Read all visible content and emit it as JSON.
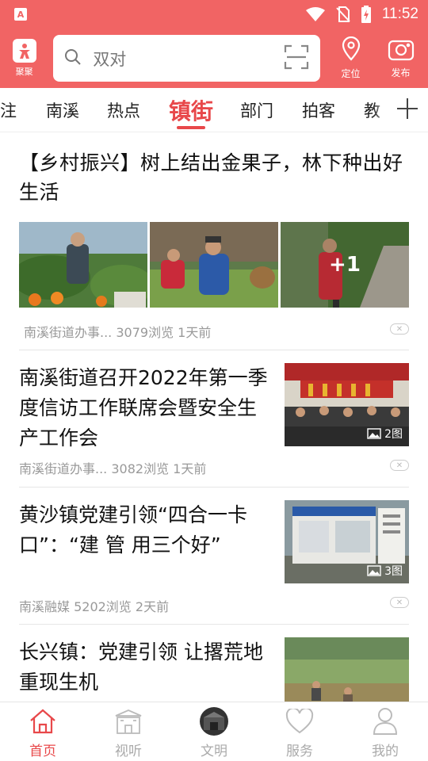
{
  "status_bar": {
    "time": "11:52",
    "app_badge": "A"
  },
  "header": {
    "logo_label": "聚聚",
    "search_placeholder": "双对",
    "location_label": "定位",
    "publish_label": "发布"
  },
  "tabs": [
    {
      "label": "注"
    },
    {
      "label": "南溪"
    },
    {
      "label": "热点"
    },
    {
      "label": "镇街",
      "active": true
    },
    {
      "label": "部门"
    },
    {
      "label": "拍客"
    },
    {
      "label": "教"
    }
  ],
  "articles": [
    {
      "title": "【乡村振兴】树上结出金果子，林下种出好生活",
      "extra_images": "+1",
      "meta": "南溪街道办事...  3079浏览  1天前"
    },
    {
      "title": "南溪街道召开2022年第一季度信访工作联席会暨安全生产工作会",
      "pic_count": "2图",
      "meta": "南溪街道办事... 3082浏览 1天前"
    },
    {
      "title": "黄沙镇党建引领“四合一卡口”：“建 管 用三个好”",
      "pic_count": "3图",
      "meta": "南溪融媒 5202浏览 2天前"
    },
    {
      "title": "长兴镇：党建引领 让撂荒地重现生机"
    }
  ],
  "tabbar": [
    {
      "label": "首页",
      "icon": "home-icon",
      "active": true
    },
    {
      "label": "视听",
      "icon": "building-icon"
    },
    {
      "label": "文明",
      "icon": "avatar-icon"
    },
    {
      "label": "服务",
      "icon": "heart-icon"
    },
    {
      "label": "我的",
      "icon": "user-icon"
    }
  ],
  "colors": {
    "brand": "#f16464",
    "accent": "#e8484a"
  }
}
